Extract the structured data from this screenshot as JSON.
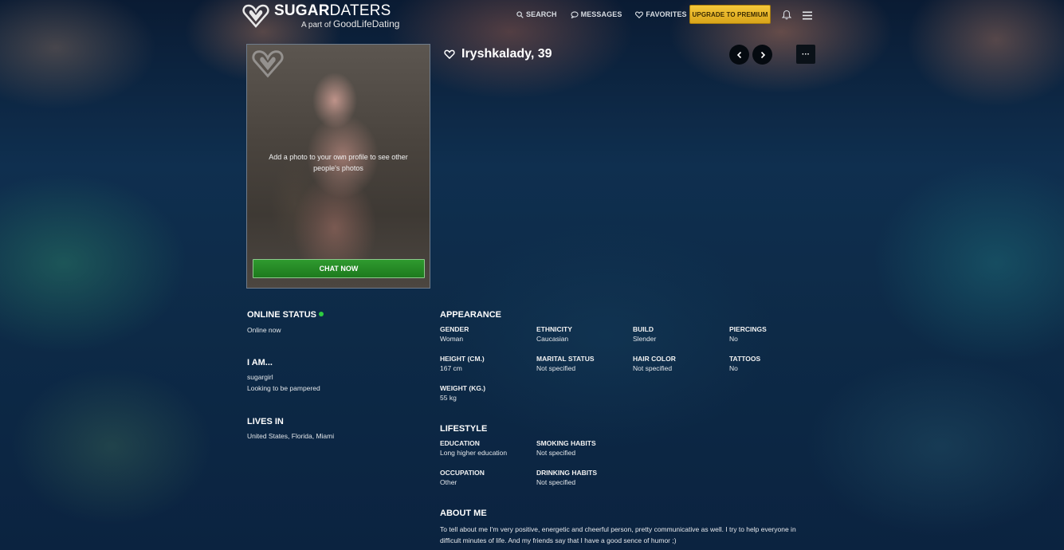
{
  "brand": {
    "name_bold": "SUGAR",
    "name_rest": "DATERS",
    "tagline_prefix": "A part of",
    "tagline_brand": "GoodLifeDating"
  },
  "nav": {
    "search": "SEARCH",
    "messages": "MESSAGES",
    "favorites": "FAVORITES",
    "upgrade": "UPGRADE TO PREMIUM"
  },
  "photo": {
    "note": "Add a photo to your own profile to see other people's photos",
    "chat_button": "CHAT NOW"
  },
  "profile": {
    "name": "Iryshkalady, 39",
    "more": "···"
  },
  "left": {
    "online": {
      "title": "ONLINE STATUS",
      "value": "Online now",
      "dot_color": "#2ecc40"
    },
    "iam": {
      "title": "I AM...",
      "line1": "sugargirl",
      "line2": "Looking to be pampered"
    },
    "lives": {
      "title": "LIVES IN",
      "value": "United States, Florida, Miami"
    }
  },
  "appearance": {
    "title": "APPEARANCE",
    "gender": {
      "label": "GENDER",
      "value": "Woman"
    },
    "ethnicity": {
      "label": "ETHNICITY",
      "value": "Caucasian"
    },
    "build": {
      "label": "BUILD",
      "value": "Slender"
    },
    "piercings": {
      "label": "PIERCINGS",
      "value": "No"
    },
    "height": {
      "label": "HEIGHT (CM.)",
      "value": "167 cm"
    },
    "marital": {
      "label": "MARITAL STATUS",
      "value": "Not specified"
    },
    "hair": {
      "label": "HAIR COLOR",
      "value": "Not specified"
    },
    "tattoos": {
      "label": "TATTOOS",
      "value": "No"
    },
    "weight": {
      "label": "WEIGHT (KG.)",
      "value": "55 kg"
    }
  },
  "lifestyle": {
    "title": "LIFESTYLE",
    "education": {
      "label": "EDUCATION",
      "value": "Long higher education"
    },
    "smoking": {
      "label": "SMOKING HABITS",
      "value": "Not specified"
    },
    "occupation": {
      "label": "OCCUPATION",
      "value": "Other"
    },
    "drinking": {
      "label": "DRINKING HABITS",
      "value": "Not specified"
    }
  },
  "about": {
    "title": "ABOUT ME",
    "line1": "To tell about me I'm very positive, energetic and cheerful person, pretty communicative as well. I try to help everyone in",
    "line2": "difficult minutes of life. And my friends say that I have a good sence of humor ;)"
  },
  "colors": {
    "upgrade": "#f5c83b",
    "chat": "#2f9a2f",
    "background": "#0c2a47"
  }
}
